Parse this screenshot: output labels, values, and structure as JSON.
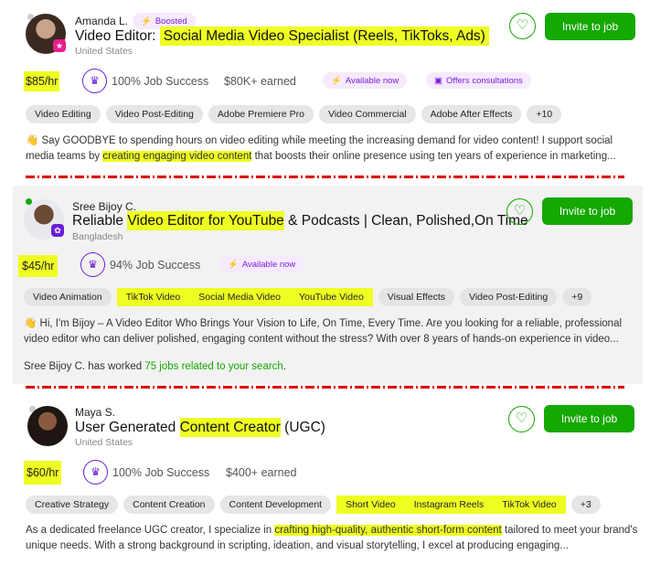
{
  "invite_label": "Invite to job",
  "freelancers": [
    {
      "name": "Amanda L.",
      "boosted": "Boosted",
      "title_pre": "Video Editor: ",
      "title_hl": "Social Media Video Specialist (Reels, TikToks, Ads)",
      "title_post": "",
      "country": "United States",
      "rate": "$85/hr",
      "job_success": "100% Job Success",
      "earned": "$80K+ earned",
      "pills": [
        "Available now",
        "Offers consultations"
      ],
      "tags": [
        "Video Editing",
        "Video Post-Editing",
        "Adobe Premiere Pro",
        "Video Commercial",
        "Adobe After Effects",
        "+10"
      ],
      "desc_1": "👋 Say GOODBYE to spending hours on video editing while meeting the increasing demand for video content! I support social media teams by ",
      "desc_hl": "creating engaging video content",
      "desc_2": " that boosts their online presence using ten years of experience in marketing..."
    },
    {
      "name": "Sree Bijoy C.",
      "title_pre": "Reliable ",
      "title_hl": "Video Editor for YouTube",
      "title_post": " & Podcasts | Clean, Polished,On Time",
      "country": "Bangladesh",
      "rate": "$45/hr",
      "job_success": "94% Job Success",
      "pills": [
        "Available now"
      ],
      "tags": [
        "Video Animation",
        "TikTok Video",
        "Social Media Video",
        "YouTube Video",
        "Visual Effects",
        "Video Post-Editing",
        "+9"
      ],
      "desc_1": "👋 Hi, I'm Bijoy – A Video Editor Who Brings Your Vision to Life, On Time, Every Time. Are you looking for a reliable, professional video editor who can deliver polished, engaging content without the stress? With over 8 years of hands-on experience in video...",
      "worked_pre": "Sree Bijoy C. has worked ",
      "worked_link": "75 jobs related to your search",
      "worked_post": "."
    },
    {
      "name": "Maya S.",
      "title_pre": "User Generated ",
      "title_hl": "Content Creator",
      "title_post": " (UGC)",
      "country": "United States",
      "rate": "$60/hr",
      "job_success": "100% Job Success",
      "earned": "$400+ earned",
      "tags": [
        "Creative Strategy",
        "Content Creation",
        "Content Development",
        "Short Video",
        "Instagram Reels",
        "TikTok Video",
        "+3"
      ],
      "desc_1": "As a dedicated freelance UGC creator, I specialize in ",
      "desc_hl": "crafting high-quality, authentic short-form content",
      "desc_2": " tailored to meet your brand's unique needs. With a strong background in scripting, ideation, and visual storytelling, I excel at producing engaging..."
    }
  ]
}
